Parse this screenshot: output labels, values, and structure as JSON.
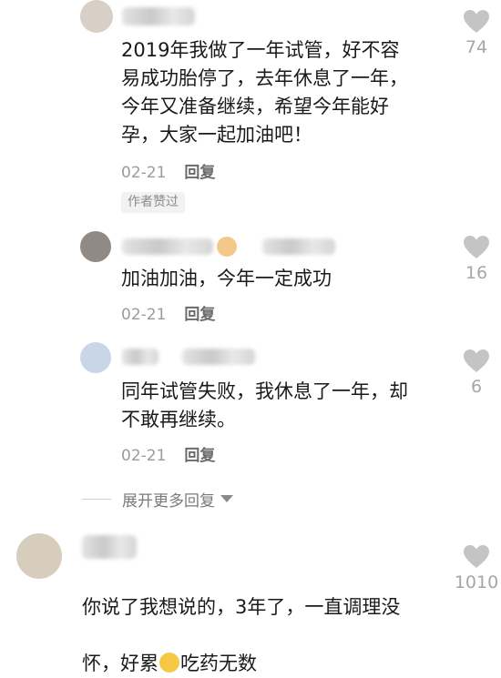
{
  "comments": [
    {
      "text": "2019年我做了一年试管，好不容\n易成功胎停了，去年休息了一年，\n今年又准备继续，希望今年能好\n孕，大家一起加油吧！",
      "date": "02-21",
      "reply_label": "回复",
      "author_tag": "作者赞过",
      "likes": "74"
    },
    {
      "text": "加油加油，今年一定成功",
      "date": "02-21",
      "reply_label": "回复",
      "likes": "16"
    },
    {
      "text": "同年试管失败，我休息了一年，却\n不敢再继续。",
      "date": "02-21",
      "reply_label": "回复",
      "likes": "6"
    },
    {
      "text_line1": "你说了我想说的，3年了，一直调理没",
      "text_line2a": "怀，好累",
      "text_line2b": "吃药无数",
      "likes": "1010"
    }
  ],
  "expand_replies_label": "展开更多回复",
  "icons": {
    "like": "heart-icon",
    "expand": "triangle-down-icon",
    "emoji_crying": "crying-face-icon",
    "emoji_dog": "dog-face-icon"
  },
  "colors": {
    "heart": "#c4c4c4",
    "secondary_text": "#9b9b9b",
    "reply": "#6a6a6a"
  }
}
